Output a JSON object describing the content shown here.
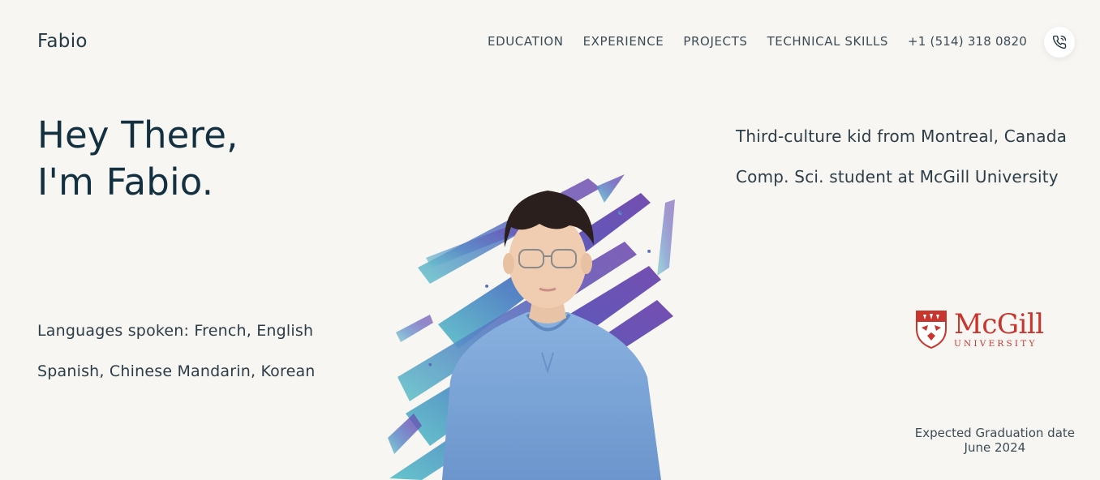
{
  "header": {
    "brand": "Fabio",
    "nav": [
      {
        "label": "EDUCATION"
      },
      {
        "label": "EXPERIENCE"
      },
      {
        "label": "PROJECTS"
      },
      {
        "label": "TECHNICAL SKILLS"
      }
    ],
    "phone": "+1 (514) 318 0820",
    "call_icon": "phone-call-icon"
  },
  "hero": {
    "title_line1": "Hey There,",
    "title_line2": "I'm Fabio."
  },
  "about": {
    "line1": "Third-culture kid from Montreal, Canada",
    "line2": "Comp. Sci. student at McGill University"
  },
  "languages": {
    "line1": "Languages spoken: French, English",
    "line2": "Spanish, Chinese Mandarin, Korean"
  },
  "university_logo": {
    "name": "McGill",
    "subtitle": "UNIVERSITY",
    "color": "#c8352e"
  },
  "graduation": {
    "label": "Expected Graduation date",
    "date": "June 2024"
  },
  "colors": {
    "background": "#f8f6f2",
    "heading": "#123040",
    "brush_purple": "#6a4bb0",
    "brush_teal": "#5ec3c9",
    "sweater": "#7aa3d6"
  }
}
